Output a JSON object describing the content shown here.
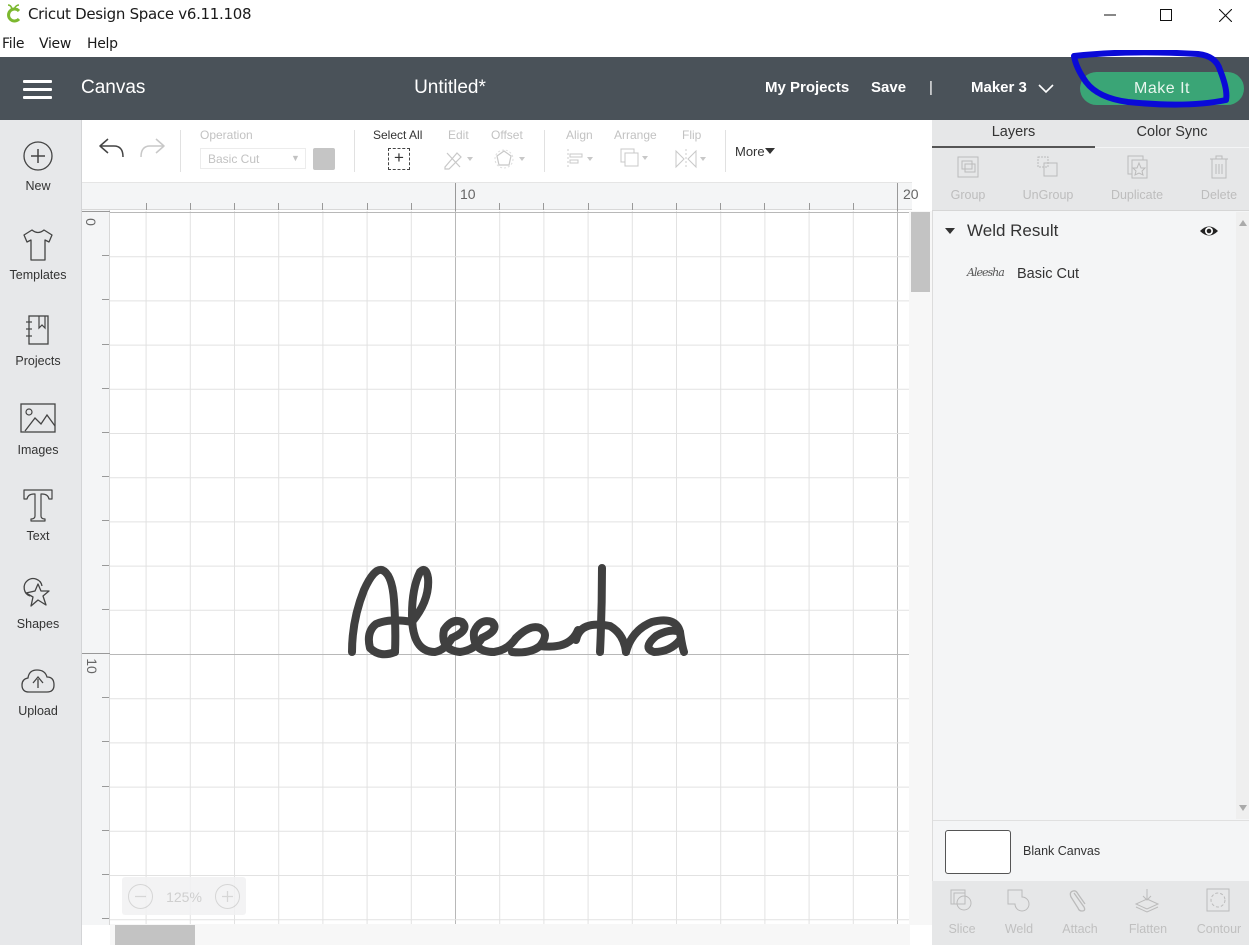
{
  "window": {
    "app_title": "Cricut Design Space  v6.11.108",
    "controls": [
      "minimize",
      "maximize",
      "close"
    ]
  },
  "menubar": {
    "items": [
      "File",
      "View",
      "Help"
    ]
  },
  "header": {
    "section": "Canvas",
    "document_title": "Untitled*",
    "my_projects": "My Projects",
    "save": "Save",
    "separator": "|",
    "machine": "Maker 3",
    "make_it": "Make It",
    "make_it_color": "#3aa576",
    "annotation_color": "#0000ee"
  },
  "sidebar": {
    "items": [
      {
        "label": "New",
        "icon": "plus-circle-icon"
      },
      {
        "label": "Templates",
        "icon": "tshirt-icon"
      },
      {
        "label": "Projects",
        "icon": "notebook-icon"
      },
      {
        "label": "Images",
        "icon": "image-icon"
      },
      {
        "label": "Text",
        "icon": "text-icon"
      },
      {
        "label": "Shapes",
        "icon": "shapes-icon"
      },
      {
        "label": "Upload",
        "icon": "cloud-upload-icon"
      }
    ]
  },
  "toolbar": {
    "undo": "undo",
    "redo": "redo",
    "operation_label": "Operation",
    "operation_value": "Basic Cut",
    "select_all": "Select All",
    "edit": "Edit",
    "offset": "Offset",
    "align": "Align",
    "arrange": "Arrange",
    "flip": "Flip",
    "more": "More"
  },
  "canvas": {
    "ruler_top": [
      "10",
      "20"
    ],
    "ruler_left": [
      "0",
      "10"
    ],
    "design_text": "Aleesha",
    "zoom_level": "125%",
    "design_color": "#404040"
  },
  "layers_panel": {
    "tabs": [
      "Layers",
      "Color Sync"
    ],
    "active_tab": "Layers",
    "actions": [
      "Group",
      "UnGroup",
      "Duplicate",
      "Delete"
    ],
    "group_name": "Weld Result",
    "layers": [
      {
        "thumb": "Aleesha",
        "operation": "Basic Cut"
      }
    ],
    "blank_canvas": "Blank Canvas",
    "bottom_actions": [
      "Slice",
      "Weld",
      "Attach",
      "Flatten",
      "Contour"
    ]
  }
}
